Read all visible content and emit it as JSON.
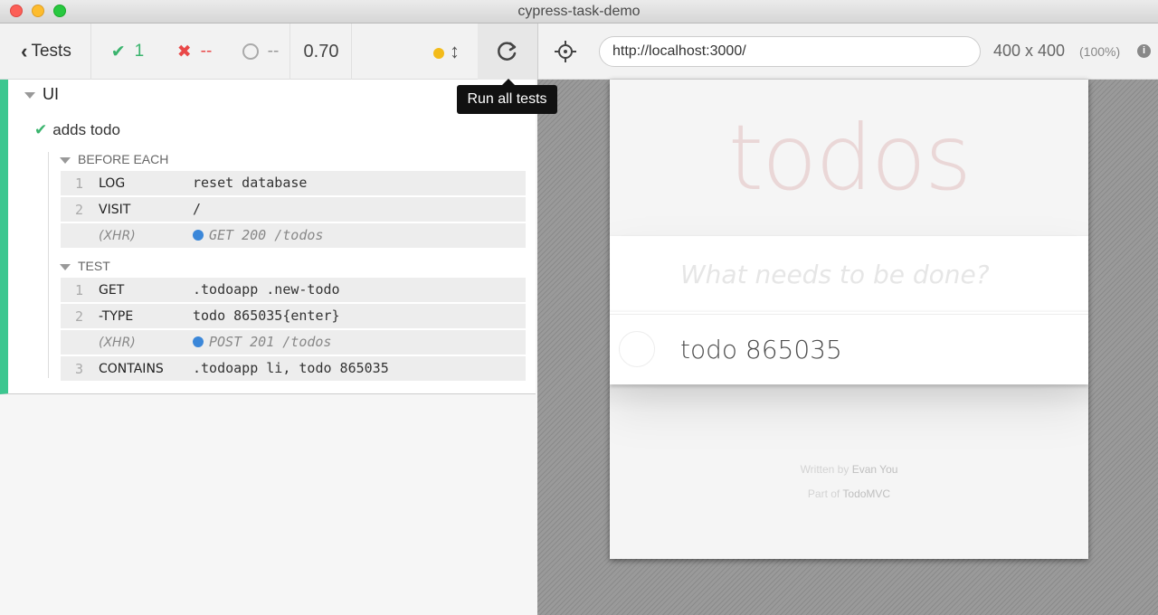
{
  "window": {
    "title": "cypress-task-demo"
  },
  "reporter": {
    "back_label": "Tests",
    "stats": {
      "passed": "1",
      "failed": "--",
      "pending": "--",
      "duration": "0.70"
    },
    "run_all_tooltip": "Run all tests",
    "suite": {
      "title": "UI",
      "test": {
        "title": "adds todo",
        "hooks": [
          {
            "name": "BEFORE EACH",
            "commands": [
              {
                "num": "1",
                "name": "LOG",
                "message": "reset database",
                "xhr": false
              },
              {
                "num": "2",
                "name": "VISIT",
                "message": "/",
                "xhr": false
              },
              {
                "num": "",
                "name": "(XHR)",
                "message": "GET 200 /todos",
                "xhr": true
              }
            ]
          },
          {
            "name": "TEST",
            "commands": [
              {
                "num": "1",
                "name": "GET",
                "message": ".todoapp .new-todo",
                "xhr": false
              },
              {
                "num": "2",
                "name": "-TYPE",
                "message": "todo 865035{enter}",
                "xhr": false
              },
              {
                "num": "",
                "name": "(XHR)",
                "message": "POST 201 /todos",
                "xhr": true
              },
              {
                "num": "3",
                "name": "CONTAINS",
                "message": ".todoapp li, todo 865035",
                "xhr": false
              }
            ]
          }
        ]
      }
    }
  },
  "aut": {
    "url": "http://localhost:3000/",
    "viewport": "400 x 400",
    "scale": "(100%)",
    "app": {
      "title": "todos",
      "new_todo_placeholder": "What needs to be done?",
      "todos": [
        "todo 865035"
      ],
      "footer": {
        "written_by_prefix": "Written by",
        "author": "Evan You",
        "part_of_prefix": "Part of",
        "project": "TodoMVC"
      }
    }
  },
  "colors": {
    "passed": "#3ab46d",
    "failed": "#e94848",
    "runnable_border": "#3cc790",
    "pending_dot": "#f3bb1a",
    "xhr_dot": "#3b87d9"
  }
}
